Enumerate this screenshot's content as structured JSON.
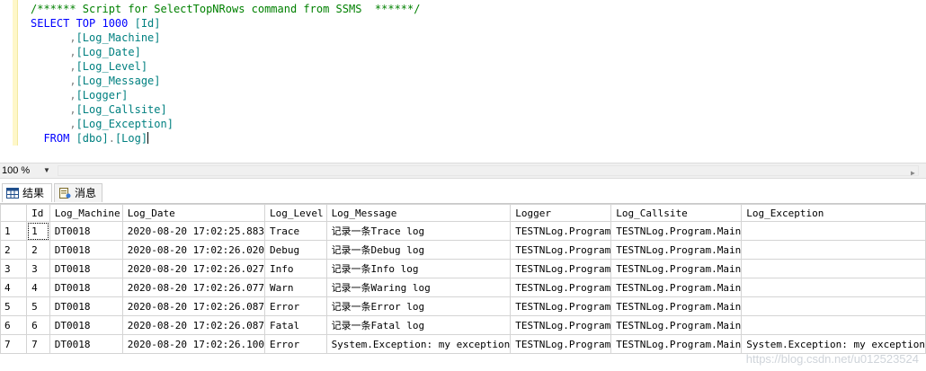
{
  "editor": {
    "lines": [
      {
        "parts": [
          {
            "t": "/****** Script for SelectTopNRows command from SSMS  ******/",
            "c": "c-comment"
          }
        ]
      },
      {
        "parts": [
          {
            "t": "SELECT TOP ",
            "c": "c-kw"
          },
          {
            "t": "1000 ",
            "c": "c-kw"
          },
          {
            "t": "[Id]",
            "c": "c-id"
          }
        ]
      },
      {
        "parts": [
          {
            "t": "      ,",
            "c": "c-punct"
          },
          {
            "t": "[Log_Machine]",
            "c": "c-id"
          }
        ]
      },
      {
        "parts": [
          {
            "t": "      ,",
            "c": "c-punct"
          },
          {
            "t": "[Log_Date]",
            "c": "c-id"
          }
        ]
      },
      {
        "parts": [
          {
            "t": "      ,",
            "c": "c-punct"
          },
          {
            "t": "[Log_Level]",
            "c": "c-id"
          }
        ]
      },
      {
        "parts": [
          {
            "t": "      ,",
            "c": "c-punct"
          },
          {
            "t": "[Log_Message]",
            "c": "c-id"
          }
        ]
      },
      {
        "parts": [
          {
            "t": "      ,",
            "c": "c-punct"
          },
          {
            "t": "[Logger]",
            "c": "c-id"
          }
        ]
      },
      {
        "parts": [
          {
            "t": "      ,",
            "c": "c-punct"
          },
          {
            "t": "[Log_Callsite]",
            "c": "c-id"
          }
        ]
      },
      {
        "parts": [
          {
            "t": "      ,",
            "c": "c-punct"
          },
          {
            "t": "[Log_Exception]",
            "c": "c-id"
          }
        ]
      },
      {
        "parts": [
          {
            "t": "  FROM ",
            "c": "c-kw"
          },
          {
            "t": "[dbo]",
            "c": "c-id"
          },
          {
            "t": ".",
            "c": "c-punct"
          },
          {
            "t": "[Log]",
            "c": "c-id"
          }
        ]
      }
    ]
  },
  "zoom": {
    "value": "100 %"
  },
  "tabs": [
    {
      "label": "结果",
      "active": true
    },
    {
      "label": "消息",
      "active": false
    }
  ],
  "grid": {
    "columns": [
      "Id",
      "Log_Machine",
      "Log_Date",
      "Log_Level",
      "Log_Message",
      "Logger",
      "Log_Callsite",
      "Log_Exception"
    ],
    "rows": [
      {
        "n": "1",
        "cells": [
          "1",
          "DT0018",
          "2020-08-20 17:02:25.883",
          "Trace",
          "记录一条Trace log",
          "TESTNLog.Program",
          "TESTNLog.Program.Main",
          ""
        ]
      },
      {
        "n": "2",
        "cells": [
          "2",
          "DT0018",
          "2020-08-20 17:02:26.020",
          "Debug",
          "记录一条Debug log",
          "TESTNLog.Program",
          "TESTNLog.Program.Main",
          ""
        ]
      },
      {
        "n": "3",
        "cells": [
          "3",
          "DT0018",
          "2020-08-20 17:02:26.027",
          "Info",
          "记录一条Info log",
          "TESTNLog.Program",
          "TESTNLog.Program.Main",
          ""
        ]
      },
      {
        "n": "4",
        "cells": [
          "4",
          "DT0018",
          "2020-08-20 17:02:26.077",
          "Warn",
          "记录一条Waring log",
          "TESTNLog.Program",
          "TESTNLog.Program.Main",
          ""
        ]
      },
      {
        "n": "5",
        "cells": [
          "5",
          "DT0018",
          "2020-08-20 17:02:26.087",
          "Error",
          "记录一条Error log",
          "TESTNLog.Program",
          "TESTNLog.Program.Main",
          ""
        ]
      },
      {
        "n": "6",
        "cells": [
          "6",
          "DT0018",
          "2020-08-20 17:02:26.087",
          "Fatal",
          "记录一条Fatal log",
          "TESTNLog.Program",
          "TESTNLog.Program.Main",
          ""
        ]
      },
      {
        "n": "7",
        "cells": [
          "7",
          "DT0018",
          "2020-08-20 17:02:26.100",
          "Error",
          "System.Exception: my exception",
          "TESTNLog.Program",
          "TESTNLog.Program.Main",
          "System.Exception: my exception"
        ]
      }
    ]
  },
  "watermark": "https://blog.csdn.net/u012523524"
}
